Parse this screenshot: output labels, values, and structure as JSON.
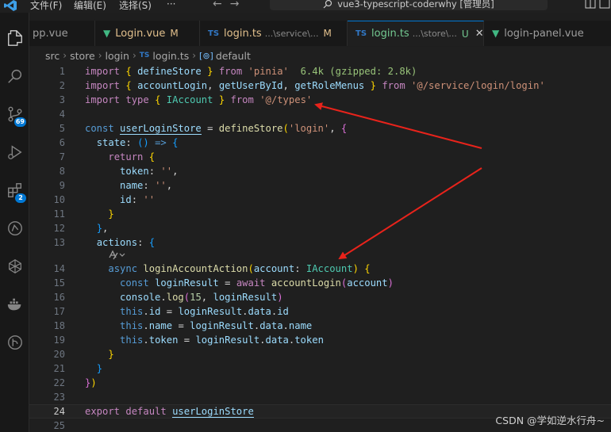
{
  "title_bar": {
    "menus": [
      "文件(F)",
      "编辑(E)",
      "选择(S)",
      "···"
    ],
    "command_center": "vue3-typescript-coderwhy [管理员]"
  },
  "activity_badges": {
    "source_control": "69",
    "extensions": "2"
  },
  "tabs": [
    {
      "label": "pp.vue",
      "icon": "vue-icon",
      "description": "",
      "status": ""
    },
    {
      "label": "Login.vue",
      "icon": "vue-icon",
      "description": "",
      "status": "M"
    },
    {
      "label": "login.ts",
      "icon": "ts-icon",
      "description": "...\\service\\...",
      "status": "M"
    },
    {
      "label": "login.ts",
      "icon": "ts-icon",
      "description": "...\\store\\...",
      "status": "U"
    },
    {
      "label": "login-panel.vue",
      "icon": "vue-icon",
      "description": "",
      "status": ""
    }
  ],
  "breadcrumb": [
    "src",
    "store",
    "login",
    "login.ts",
    "default"
  ],
  "editor": {
    "current_line": "24",
    "line_numbers": [
      "1",
      "2",
      "3",
      "4",
      "5",
      "6",
      "7",
      "8",
      "9",
      "10",
      "11",
      "12",
      "13",
      "14",
      "15",
      "16",
      "17",
      "18",
      "19",
      "20",
      "21",
      "22",
      "23",
      "24",
      "25"
    ],
    "code": {
      "import": "import",
      "from": "from",
      "type": "type",
      "const": "const",
      "return": "return",
      "async": "async",
      "await": "await",
      "this": "this",
      "export": "export",
      "default": "default",
      "defineStore": "defineStore",
      "pinia": "'pinia'",
      "size_info": "6.4k (gzipped: 2.8k)",
      "accountLogin": "accountLogin",
      "getUserById": "getUserById",
      "getRoleMenus": "getRoleMenus",
      "service_path": "'@/service/login/login'",
      "IAccount": "IAccount",
      "types_path": "'@/types'",
      "userLoginStore": "userLoginStore",
      "login_str": "'login'",
      "state": "state",
      "token": "token",
      "name": "name",
      "id": "id",
      "empty_str": "''",
      "actions": "actions",
      "loginAccountAction": "loginAccountAction",
      "account": "account",
      "loginResult": "loginResult",
      "console": "console",
      "log": "log",
      "num15": "15",
      "data": "data"
    }
  },
  "watermark": "CSDN @学如逆水行舟~"
}
